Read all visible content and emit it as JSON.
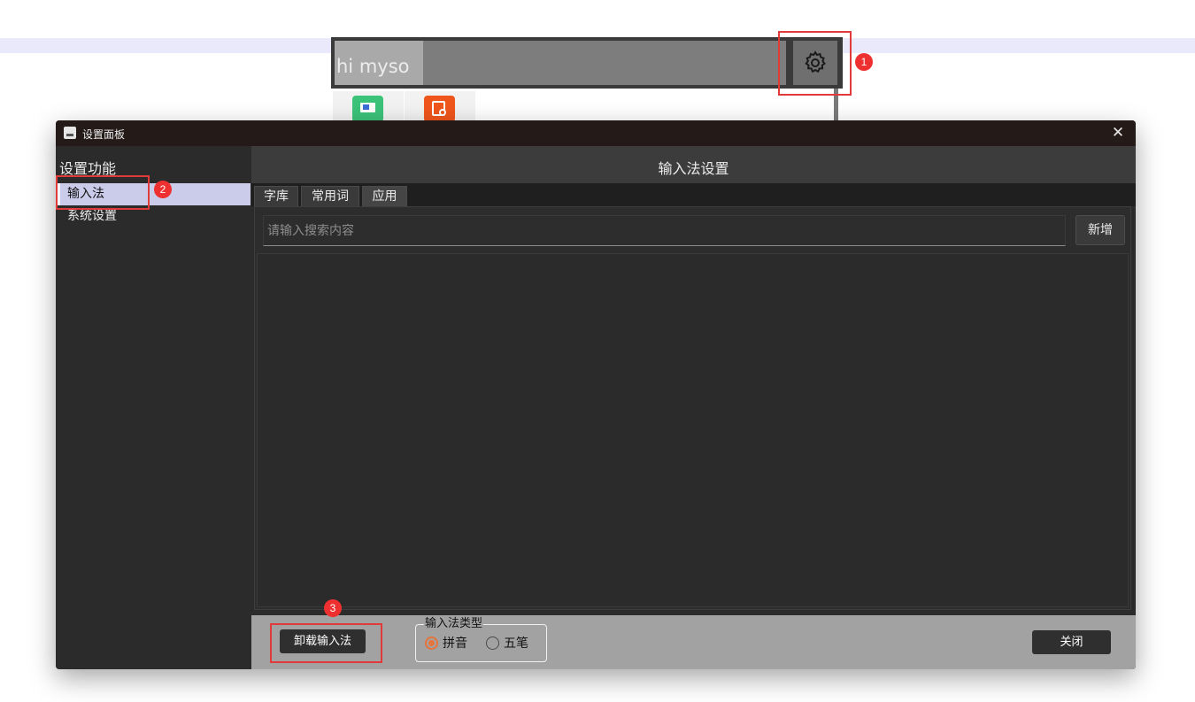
{
  "ime_bar": {
    "input_text": "hi myso"
  },
  "icons": {
    "gear": "gear-icon",
    "app_one": "monitor-app-icon",
    "app_two": "search-doc-app-icon"
  },
  "annotations": [
    "1",
    "2",
    "3"
  ],
  "window": {
    "title": "设置面板",
    "close_symbol": "✕",
    "sidebar": {
      "heading": "设置功能",
      "items": [
        {
          "label": "输入法",
          "active": true
        },
        {
          "label": "系统设置",
          "active": false
        }
      ]
    },
    "main": {
      "title": "输入法设置",
      "tabs": [
        {
          "label": "字库"
        },
        {
          "label": "常用词"
        },
        {
          "label": "应用",
          "active": true
        }
      ],
      "search_placeholder": "请输入搜索内容",
      "add_label": "新增"
    },
    "footer": {
      "uninstall_label": "卸载输入法",
      "type_group_label": "输入法类型",
      "options": [
        {
          "label": "拼音",
          "selected": true
        },
        {
          "label": "五笔",
          "selected": false
        }
      ],
      "close_label": "关闭"
    }
  },
  "colors": {
    "accent": "#e5743d",
    "highlight": "#e03a3a",
    "sidebar_active": "#cbcbea"
  }
}
